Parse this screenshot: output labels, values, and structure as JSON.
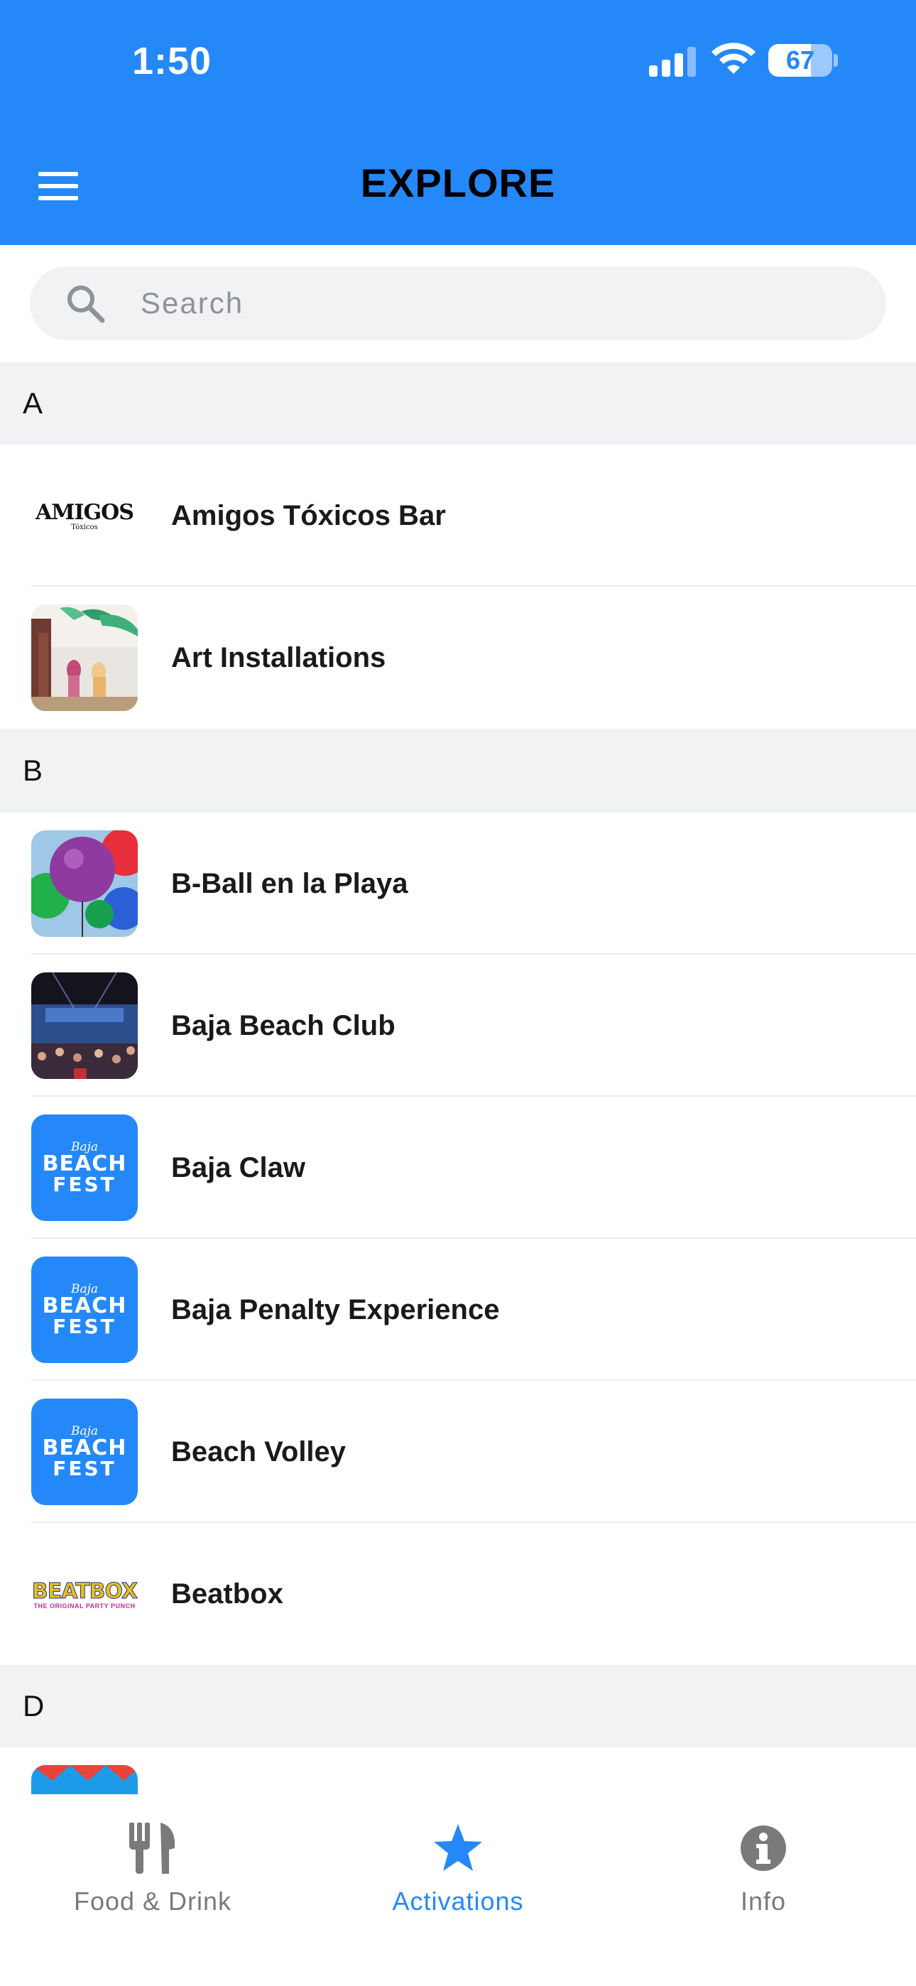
{
  "status_bar": {
    "time": "1:50",
    "battery": "67",
    "battery_level": 0.67
  },
  "header": {
    "title": "EXPLORE",
    "menu_icon": "hamburger-menu-icon",
    "background_color": "#2588f8"
  },
  "search": {
    "placeholder": "Search",
    "value": "",
    "icon": "search-icon"
  },
  "list": {
    "sections": [
      {
        "letter": "A",
        "items": [
          {
            "label": "Amigos Tóxicos Bar",
            "thumb": "amigos-logo",
            "logo_text": "AMIGOS",
            "logo_subtext": "Tóxicos"
          },
          {
            "label": "Art Installations",
            "thumb": "art-photo"
          }
        ]
      },
      {
        "letter": "B",
        "items": [
          {
            "label": "B-Ball en la Playa",
            "thumb": "balloons-photo"
          },
          {
            "label": "Baja Beach Club",
            "thumb": "crowd-photo"
          },
          {
            "label": "Baja Claw",
            "thumb": "baja-beach-fest-logo"
          },
          {
            "label": "Baja Penalty Experience",
            "thumb": "baja-beach-fest-logo"
          },
          {
            "label": "Beach Volley",
            "thumb": "baja-beach-fest-logo"
          },
          {
            "label": "Beatbox",
            "thumb": "beatbox-logo",
            "logo_text": "BEATBOX",
            "logo_subtext": "THE ORIGINAL PARTY PUNCH"
          }
        ]
      },
      {
        "letter": "D",
        "items": []
      }
    ],
    "fest_logo": {
      "line1": "Baja",
      "line2": "BEACH",
      "line3": "FEST"
    }
  },
  "tabbar": {
    "tabs": [
      {
        "label": "Food & Drink",
        "icon": "fork-knife-icon",
        "active": false
      },
      {
        "label": "Activations",
        "icon": "star-icon",
        "active": true
      },
      {
        "label": "Info",
        "icon": "info-icon",
        "active": false
      }
    ],
    "active_color": "#2588f8",
    "inactive_color": "#7a7a7a"
  }
}
